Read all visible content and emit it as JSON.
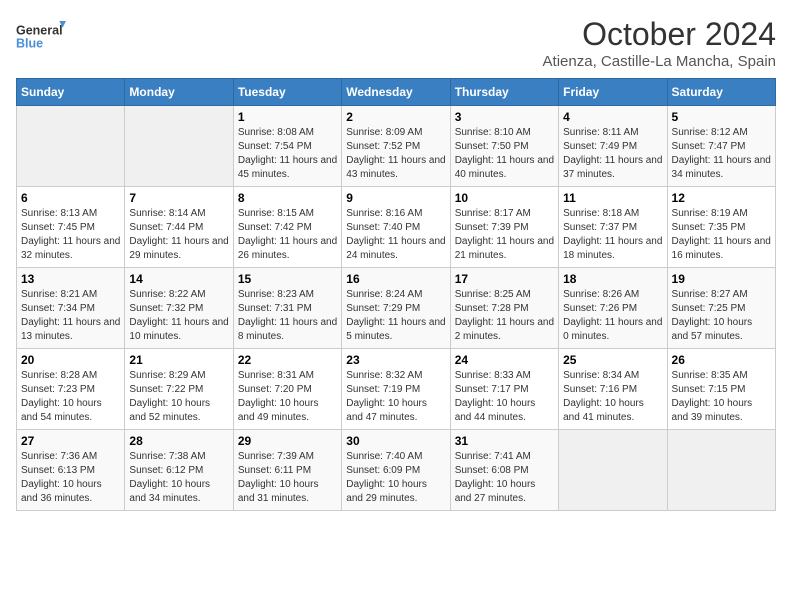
{
  "logo": {
    "line1": "General",
    "line2": "Blue"
  },
  "title": "October 2024",
  "subtitle": "Atienza, Castille-La Mancha, Spain",
  "days_of_week": [
    "Sunday",
    "Monday",
    "Tuesday",
    "Wednesday",
    "Thursday",
    "Friday",
    "Saturday"
  ],
  "weeks": [
    [
      {
        "day": "",
        "info": ""
      },
      {
        "day": "",
        "info": ""
      },
      {
        "day": "1",
        "info": "Sunrise: 8:08 AM\nSunset: 7:54 PM\nDaylight: 11 hours and 45 minutes."
      },
      {
        "day": "2",
        "info": "Sunrise: 8:09 AM\nSunset: 7:52 PM\nDaylight: 11 hours and 43 minutes."
      },
      {
        "day": "3",
        "info": "Sunrise: 8:10 AM\nSunset: 7:50 PM\nDaylight: 11 hours and 40 minutes."
      },
      {
        "day": "4",
        "info": "Sunrise: 8:11 AM\nSunset: 7:49 PM\nDaylight: 11 hours and 37 minutes."
      },
      {
        "day": "5",
        "info": "Sunrise: 8:12 AM\nSunset: 7:47 PM\nDaylight: 11 hours and 34 minutes."
      }
    ],
    [
      {
        "day": "6",
        "info": "Sunrise: 8:13 AM\nSunset: 7:45 PM\nDaylight: 11 hours and 32 minutes."
      },
      {
        "day": "7",
        "info": "Sunrise: 8:14 AM\nSunset: 7:44 PM\nDaylight: 11 hours and 29 minutes."
      },
      {
        "day": "8",
        "info": "Sunrise: 8:15 AM\nSunset: 7:42 PM\nDaylight: 11 hours and 26 minutes."
      },
      {
        "day": "9",
        "info": "Sunrise: 8:16 AM\nSunset: 7:40 PM\nDaylight: 11 hours and 24 minutes."
      },
      {
        "day": "10",
        "info": "Sunrise: 8:17 AM\nSunset: 7:39 PM\nDaylight: 11 hours and 21 minutes."
      },
      {
        "day": "11",
        "info": "Sunrise: 8:18 AM\nSunset: 7:37 PM\nDaylight: 11 hours and 18 minutes."
      },
      {
        "day": "12",
        "info": "Sunrise: 8:19 AM\nSunset: 7:35 PM\nDaylight: 11 hours and 16 minutes."
      }
    ],
    [
      {
        "day": "13",
        "info": "Sunrise: 8:21 AM\nSunset: 7:34 PM\nDaylight: 11 hours and 13 minutes."
      },
      {
        "day": "14",
        "info": "Sunrise: 8:22 AM\nSunset: 7:32 PM\nDaylight: 11 hours and 10 minutes."
      },
      {
        "day": "15",
        "info": "Sunrise: 8:23 AM\nSunset: 7:31 PM\nDaylight: 11 hours and 8 minutes."
      },
      {
        "day": "16",
        "info": "Sunrise: 8:24 AM\nSunset: 7:29 PM\nDaylight: 11 hours and 5 minutes."
      },
      {
        "day": "17",
        "info": "Sunrise: 8:25 AM\nSunset: 7:28 PM\nDaylight: 11 hours and 2 minutes."
      },
      {
        "day": "18",
        "info": "Sunrise: 8:26 AM\nSunset: 7:26 PM\nDaylight: 11 hours and 0 minutes."
      },
      {
        "day": "19",
        "info": "Sunrise: 8:27 AM\nSunset: 7:25 PM\nDaylight: 10 hours and 57 minutes."
      }
    ],
    [
      {
        "day": "20",
        "info": "Sunrise: 8:28 AM\nSunset: 7:23 PM\nDaylight: 10 hours and 54 minutes."
      },
      {
        "day": "21",
        "info": "Sunrise: 8:29 AM\nSunset: 7:22 PM\nDaylight: 10 hours and 52 minutes."
      },
      {
        "day": "22",
        "info": "Sunrise: 8:31 AM\nSunset: 7:20 PM\nDaylight: 10 hours and 49 minutes."
      },
      {
        "day": "23",
        "info": "Sunrise: 8:32 AM\nSunset: 7:19 PM\nDaylight: 10 hours and 47 minutes."
      },
      {
        "day": "24",
        "info": "Sunrise: 8:33 AM\nSunset: 7:17 PM\nDaylight: 10 hours and 44 minutes."
      },
      {
        "day": "25",
        "info": "Sunrise: 8:34 AM\nSunset: 7:16 PM\nDaylight: 10 hours and 41 minutes."
      },
      {
        "day": "26",
        "info": "Sunrise: 8:35 AM\nSunset: 7:15 PM\nDaylight: 10 hours and 39 minutes."
      }
    ],
    [
      {
        "day": "27",
        "info": "Sunrise: 7:36 AM\nSunset: 6:13 PM\nDaylight: 10 hours and 36 minutes."
      },
      {
        "day": "28",
        "info": "Sunrise: 7:38 AM\nSunset: 6:12 PM\nDaylight: 10 hours and 34 minutes."
      },
      {
        "day": "29",
        "info": "Sunrise: 7:39 AM\nSunset: 6:11 PM\nDaylight: 10 hours and 31 minutes."
      },
      {
        "day": "30",
        "info": "Sunrise: 7:40 AM\nSunset: 6:09 PM\nDaylight: 10 hours and 29 minutes."
      },
      {
        "day": "31",
        "info": "Sunrise: 7:41 AM\nSunset: 6:08 PM\nDaylight: 10 hours and 27 minutes."
      },
      {
        "day": "",
        "info": ""
      },
      {
        "day": "",
        "info": ""
      }
    ]
  ]
}
